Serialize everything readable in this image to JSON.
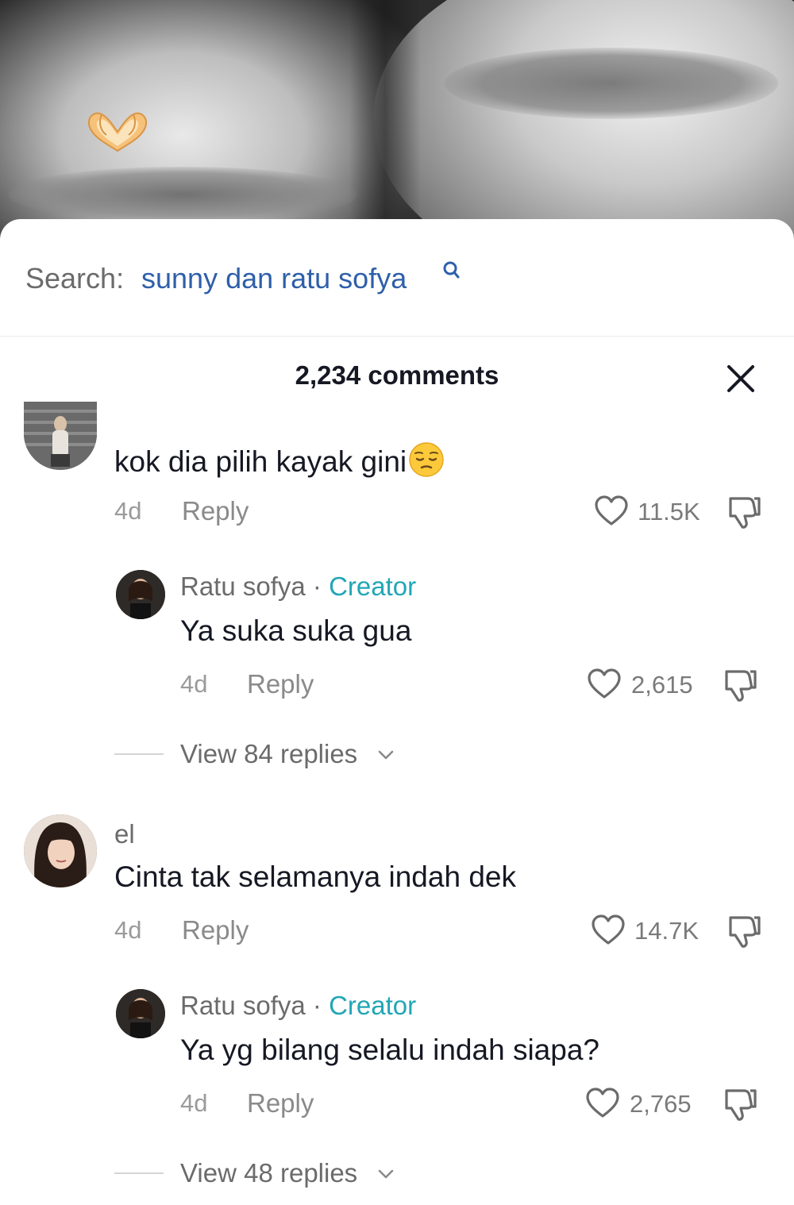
{
  "video": {
    "overlay_icon": "heart-hands-emoji"
  },
  "search": {
    "label": "Search:",
    "term": "sunny dan ratu sofya",
    "icon": "search-icon"
  },
  "header": {
    "title": "2,234 comments",
    "close_icon": "close-icon"
  },
  "comments": [
    {
      "username": "",
      "text": "kok dia pilih kayak gini",
      "emoji": "pensive-face-emoji",
      "time": "4d",
      "reply_label": "Reply",
      "likes": "11.5K",
      "reply": {
        "username": "Ratu sofya",
        "separator": " · ",
        "badge": "Creator",
        "text": "Ya suka suka gua",
        "time": "4d",
        "reply_label": "Reply",
        "likes": "2,615"
      },
      "view_replies": "View 84 replies"
    },
    {
      "username": "el",
      "text": "Cinta tak selamanya indah dek",
      "time": "4d",
      "reply_label": "Reply",
      "likes": "14.7K",
      "reply": {
        "username": "Ratu sofya",
        "separator": " · ",
        "badge": "Creator",
        "text": "Ya yg bilang selalu indah siapa?",
        "time": "4d",
        "reply_label": "Reply",
        "likes": "2,765"
      },
      "view_replies": "View 48 replies"
    }
  ],
  "colors": {
    "link": "#2e5fa9",
    "creator_badge": "#21a6b5",
    "text": "#161823",
    "muted": "#8a8a8a"
  }
}
